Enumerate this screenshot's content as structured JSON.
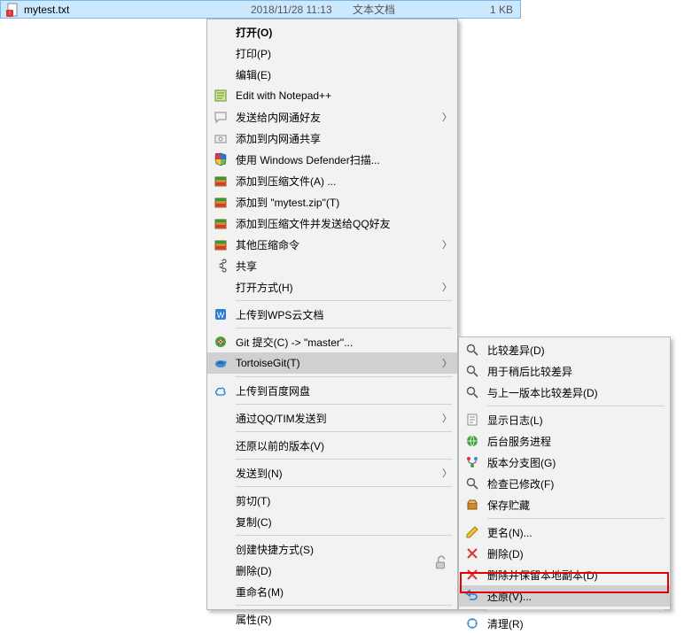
{
  "file": {
    "name": "mytest.txt",
    "date": "2018/11/28 11:13",
    "type": "文本文档",
    "size": "1 KB"
  },
  "menu1": {
    "open": "打开(O)",
    "print": "打印(P)",
    "edit": "编辑(E)",
    "notepadpp": "Edit with Notepad++",
    "send_friend": "发送给内网通好友",
    "add_share": "添加到内网通共享",
    "defender": "使用 Windows Defender扫描...",
    "add_archive": "添加到压缩文件(A) ...",
    "add_zip": "添加到 \"mytest.zip\"(T)",
    "add_send_qq": "添加到压缩文件并发送给QQ好友",
    "other_zip": "其他压缩命令",
    "share": "共享",
    "open_with": "打开方式(H)",
    "wps_cloud": "上传到WPS云文档",
    "git_commit": "Git 提交(C) -> \"master\"...",
    "tortoisegit": "TortoiseGit(T)",
    "baidu": "上传到百度网盘",
    "qq_tim": "通过QQ/TIM发送到",
    "restore_prev": "还原以前的版本(V)",
    "send_to": "发送到(N)",
    "cut": "剪切(T)",
    "copy": "复制(C)",
    "shortcut": "创建快捷方式(S)",
    "delete": "删除(D)",
    "rename": "重命名(M)",
    "properties": "属性(R)"
  },
  "menu2": {
    "diff": "比较差异(D)",
    "diff_later": "用于稍后比较差异",
    "diff_prev": "与上一版本比较差异(D)",
    "log": "显示日志(L)",
    "daemon": "后台服务进程",
    "branch_graph": "版本分支图(G)",
    "check_mod": "检查已修改(F)",
    "stash": "保存贮藏",
    "rename": "更名(N)...",
    "delete": "删除(D)",
    "delete_keep": "删除并保留本地副本(D)",
    "revert": "还原(V)...",
    "cleanup": "清理(R)"
  }
}
